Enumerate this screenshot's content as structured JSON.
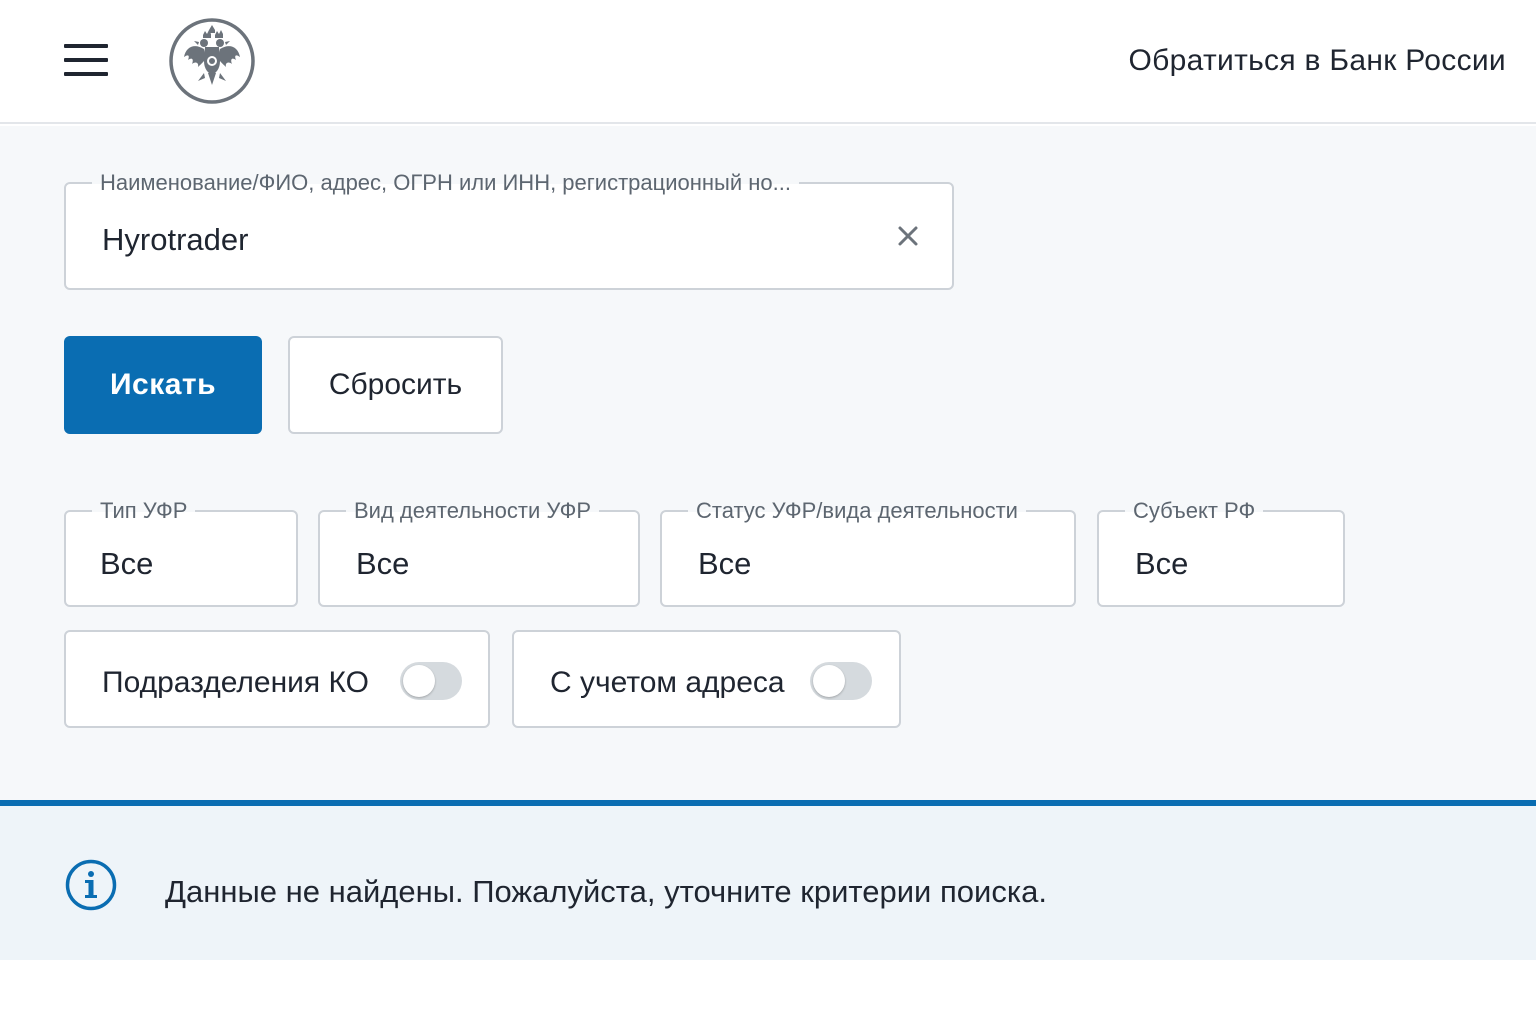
{
  "header": {
    "menu_icon": "hamburger-menu-icon",
    "logo": "bank-of-russia-eagle-emblem",
    "contact_link": "Обратиться в Банк России"
  },
  "search": {
    "legend": "Наименование/ФИО, адрес, ОГРН или ИНН, регистрационный но...",
    "value": "Hyrotrader",
    "clear_icon": "close-icon"
  },
  "buttons": {
    "search_label": "Искать",
    "reset_label": "Сбросить"
  },
  "filters": [
    {
      "legend": "Тип УФР",
      "value": "Все"
    },
    {
      "legend": "Вид деятельности УФР",
      "value": "Все"
    },
    {
      "legend": "Статус УФР/вида деятельности",
      "value": "Все"
    },
    {
      "legend": "Субъект РФ",
      "value": "Все"
    }
  ],
  "toggles": [
    {
      "label": "Подразделения КО",
      "on": false
    },
    {
      "label": "С учетом адреса",
      "on": false
    }
  ],
  "info": {
    "icon": "info-icon",
    "message": "Данные не найдены. Пожалуйста, уточните критерии поиска."
  },
  "colors": {
    "accent": "#0a6db2",
    "border": "#cdd2d8",
    "text": "#1f2530",
    "muted_text": "#5d6670",
    "banner_bg": "#eef4f9"
  }
}
